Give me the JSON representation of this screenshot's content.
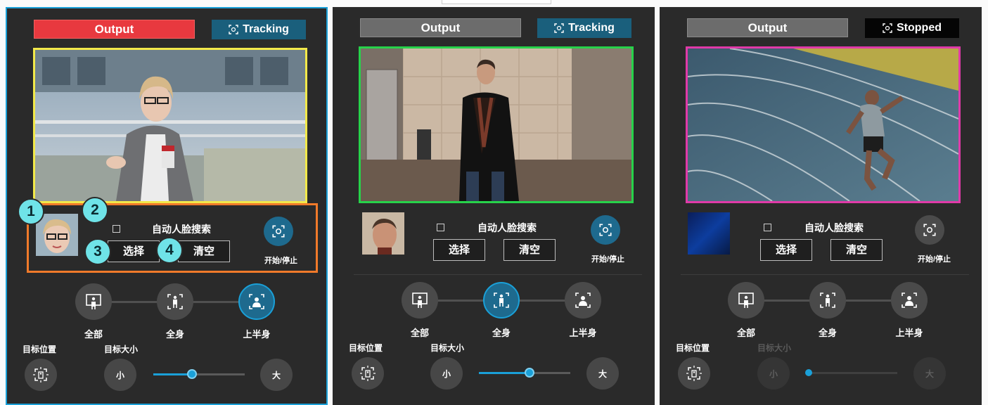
{
  "colors": {
    "accent": "#1aa0d8",
    "output_active": "#e8393f",
    "tracking": "#1a5f7c",
    "stopped": "#050505",
    "badge": "#6fe3e8"
  },
  "icons": {
    "tracking": "crosshair-frame-icon",
    "mode_all": "person-in-frame-icon",
    "mode_full_body": "full-body-icon",
    "mode_upper_body": "upper-body-icon",
    "target_position": "target-position-icon"
  },
  "annotations": [
    "1",
    "2",
    "3",
    "4"
  ],
  "panels": [
    {
      "output_label": "Output",
      "status_label": "Tracking",
      "auto_face_search": "自动人脸搜索",
      "select_label": "选择",
      "clear_label": "清空",
      "start_stop_label": "开始/停止",
      "modes": [
        "全部",
        "全身",
        "上半身"
      ],
      "selected_mode": "上半身",
      "target_position_label": "目标位置",
      "target_size_label": "目标大小",
      "size_small": "小",
      "size_large": "大",
      "size_slider_value": 0.42
    },
    {
      "output_label": "Output",
      "status_label": "Tracking",
      "auto_face_search": "自动人脸搜索",
      "select_label": "选择",
      "clear_label": "清空",
      "start_stop_label": "开始/停止",
      "modes": [
        "全部",
        "全身",
        "上半身"
      ],
      "selected_mode": "全身",
      "target_position_label": "目标位置",
      "target_size_label": "目标大小",
      "size_small": "小",
      "size_large": "大",
      "size_slider_value": 0.55
    },
    {
      "output_label": "Output",
      "status_label": "Stopped",
      "auto_face_search": "自动人脸搜索",
      "select_label": "选择",
      "clear_label": "清空",
      "start_stop_label": "开始/停止",
      "modes": [
        "全部",
        "全身",
        "上半身"
      ],
      "selected_mode": "",
      "target_position_label": "目标位置",
      "target_size_label": "目标大小",
      "size_small": "小",
      "size_large": "大",
      "size_slider_value": 0.0
    }
  ]
}
